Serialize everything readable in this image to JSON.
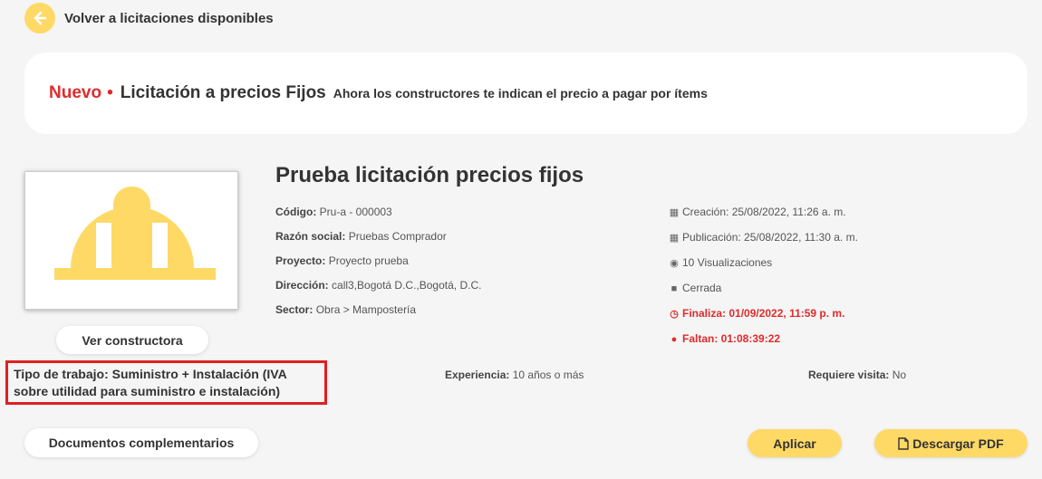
{
  "back": {
    "label": "Volver a licitaciones disponibles",
    "icon": "arrow-left-icon"
  },
  "banner": {
    "badge": "Nuevo",
    "separator": "•",
    "title": "Licitación a precios Fijos",
    "subtitle": "Ahora los constructores te indican el precio a pagar por ítems"
  },
  "logo": {
    "icon": "hard-hat-icon",
    "color": "#ffd966"
  },
  "ver_constructora": "Ver constructora",
  "title": "Prueba licitación precios fijos",
  "details": {
    "codigo_label": "Código:",
    "codigo": "Pru-a - 000003",
    "razon_label": "Razón social:",
    "razon": "Pruebas Comprador",
    "proyecto_label": "Proyecto:",
    "proyecto": "Proyecto prueba",
    "direccion_label": "Dirección:",
    "direccion": "call3,Bogotá D.C.,Bogotá, D.C.",
    "sector_label": "Sector:",
    "sector": "Obra > Mampostería"
  },
  "meta": {
    "creacion": "Creación: 25/08/2022, 11:26 a. m.",
    "publicacion": "Publicación: 25/08/2022, 11:30 a. m.",
    "visualizaciones": "10 Visualizaciones",
    "estado": "Cerrada",
    "finaliza": "Finaliza: 01/09/2022, 11:59 p. m.",
    "faltan": "Faltan: 01:08:39:22"
  },
  "tipo_trabajo": "Tipo de trabajo: Suministro + Instalación (IVA sobre utilidad para suministro e instalación)",
  "experiencia_label": "Experiencia:",
  "experiencia": "10 años o más",
  "visita_label": "Requiere visita:",
  "visita": "No",
  "docs_button": "Documentos complementarios",
  "aplicar_button": "Aplicar",
  "pdf_button": "Descargar PDF",
  "colors": {
    "accent": "#ffd966",
    "alert": "#e02b2b",
    "highlight_border": "#e02020"
  }
}
